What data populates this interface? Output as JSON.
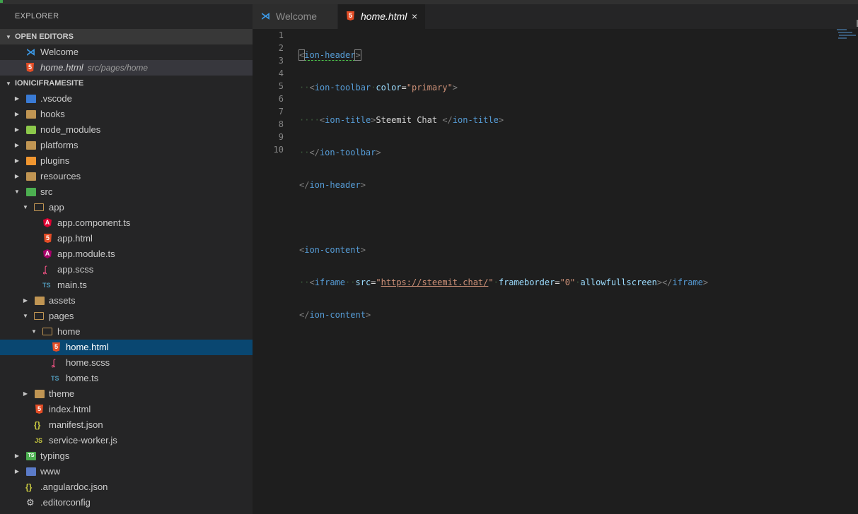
{
  "explorer": {
    "title": "EXPLORER",
    "open_editors": {
      "header": "OPEN EDITORS",
      "items": [
        {
          "label": "Welcome",
          "desc": ""
        },
        {
          "label": "home.html",
          "desc": "src/pages/home"
        }
      ]
    },
    "project": {
      "header": "IONICIFRAMESITE",
      "items": [
        {
          "label": ".vscode"
        },
        {
          "label": "hooks"
        },
        {
          "label": "node_modules"
        },
        {
          "label": "platforms"
        },
        {
          "label": "plugins"
        },
        {
          "label": "resources"
        },
        {
          "label": "src"
        },
        {
          "label": "app"
        },
        {
          "label": "app.component.ts"
        },
        {
          "label": "app.html"
        },
        {
          "label": "app.module.ts"
        },
        {
          "label": "app.scss"
        },
        {
          "label": "main.ts"
        },
        {
          "label": "assets"
        },
        {
          "label": "pages"
        },
        {
          "label": "home"
        },
        {
          "label": "home.html"
        },
        {
          "label": "home.scss"
        },
        {
          "label": "home.ts"
        },
        {
          "label": "theme"
        },
        {
          "label": "index.html"
        },
        {
          "label": "manifest.json"
        },
        {
          "label": "service-worker.js"
        },
        {
          "label": "typings"
        },
        {
          "label": "www"
        },
        {
          "label": ".angulardoc.json"
        },
        {
          "label": ".editorconfig"
        }
      ]
    }
  },
  "tabs": [
    {
      "label": "Welcome",
      "close": ""
    },
    {
      "label": "home.html",
      "close": "×"
    }
  ],
  "editor": {
    "line_numbers": [
      "1",
      "2",
      "3",
      "4",
      "5",
      "6",
      "7",
      "8",
      "9",
      "10"
    ],
    "code": {
      "l1": {
        "tag": "ion-header"
      },
      "l2": {
        "tag": "ion-toolbar",
        "attr": "color",
        "val": "\"primary\""
      },
      "l3": {
        "tag": "ion-title",
        "text": "Steemit Chat ",
        "close": "ion-title"
      },
      "l4": {
        "close": "ion-toolbar"
      },
      "l5": {
        "close": "ion-header"
      },
      "l7": {
        "tag": "ion-content"
      },
      "l8": {
        "tag": "iframe",
        "attr1": "src",
        "url": "https://steemit.chat/",
        "attr2": "frameborder",
        "val2": "\"0\"",
        "attr3": "allowfullscreen",
        "close": "iframe"
      },
      "l9": {
        "close": "ion-content"
      }
    }
  },
  "icons": {
    "vscode": "vscode-icon",
    "html": "html5-icon",
    "folder": "folder-icon",
    "close": "close-icon"
  },
  "colors": {
    "selection": "#094771",
    "html_icon": "#e44d26",
    "tag": "#569cd6",
    "attribute": "#9cdcfe",
    "string": "#ce9178"
  }
}
